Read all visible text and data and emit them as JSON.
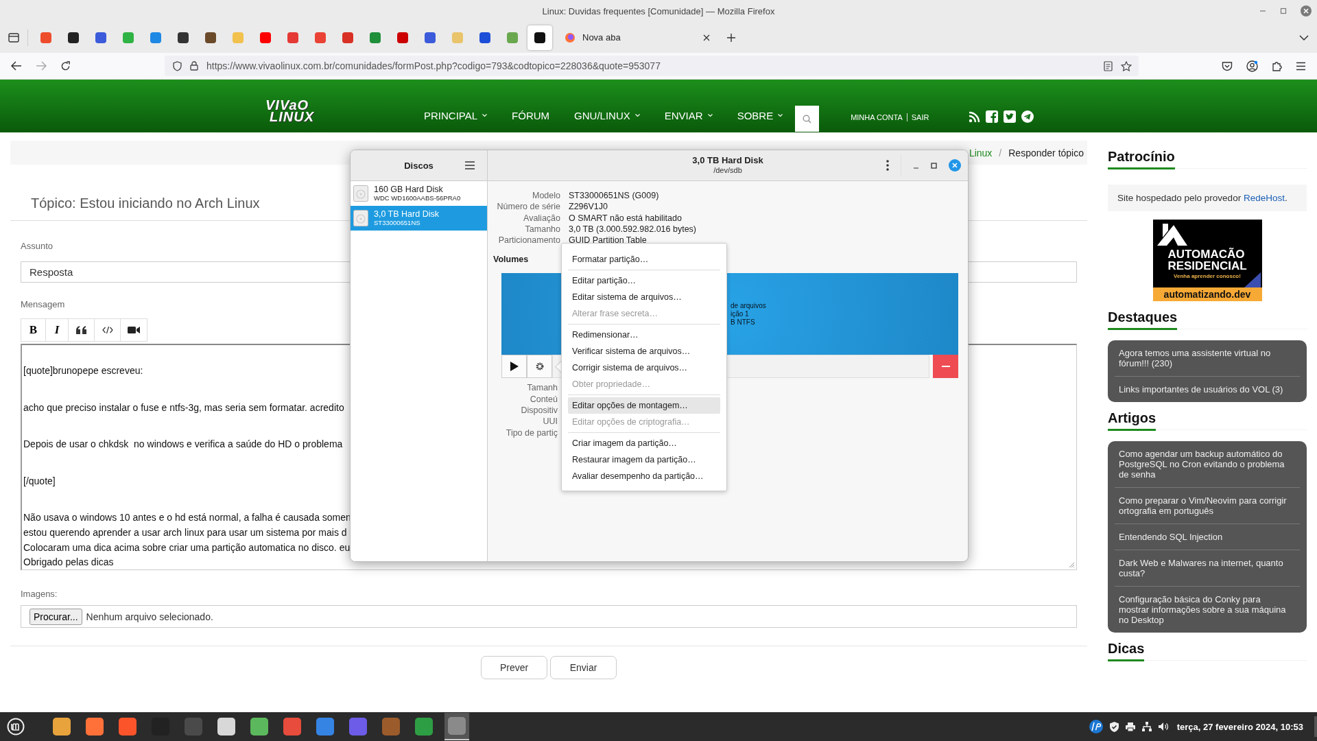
{
  "browser": {
    "window_title": "Linux: Duvidas frequentes [Comunidade] — Mozilla Firefox",
    "pinned_tabs": [
      {
        "color": "#ee4d2d",
        "selected": false
      },
      {
        "color": "#222222",
        "selected": false
      },
      {
        "color": "#3b5bdb",
        "selected": false
      },
      {
        "color": "#2fb344",
        "selected": false
      },
      {
        "color": "#1e88e5",
        "selected": false
      },
      {
        "color": "#333333",
        "selected": false
      },
      {
        "color": "#6b4a2a",
        "selected": false
      },
      {
        "color": "#f2c14e",
        "selected": false
      },
      {
        "color": "#ff0000",
        "selected": false
      },
      {
        "color": "#e53935",
        "selected": false
      },
      {
        "color": "#ea4335",
        "selected": false
      },
      {
        "color": "#d93025",
        "selected": false
      },
      {
        "color": "#1f8f3a",
        "selected": false
      },
      {
        "color": "#cc0000",
        "selected": false
      },
      {
        "color": "#3b5bdb",
        "selected": false
      },
      {
        "color": "#e9c46a",
        "selected": false
      },
      {
        "color": "#1d4ed8",
        "selected": false
      },
      {
        "color": "#6aa84f",
        "selected": false
      },
      {
        "color": "#111111",
        "selected": true
      }
    ],
    "tabs": [
      {
        "label": "Nova aba",
        "selected": false
      }
    ],
    "url": "https://www.vivaolinux.com.br/comunidades/formPost.php?codigo=793&codtopico=228036&quote=953077"
  },
  "site_header": {
    "logo": [
      "VIVaO",
      "LINUX"
    ],
    "nav": [
      {
        "label": "PRINCIPAL",
        "dropdown": true
      },
      {
        "label": "FÓRUM",
        "dropdown": false
      },
      {
        "label": "GNU/LINUX",
        "dropdown": true
      },
      {
        "label": "ENVIAR",
        "dropdown": true
      },
      {
        "label": "SOBRE",
        "dropdown": true
      }
    ],
    "account_links": [
      "MINHA CONTA",
      "SAIR"
    ]
  },
  "breadcrumb": {
    "items": [
      "Linux",
      "Responder tópico"
    ],
    "separator": "/"
  },
  "form": {
    "topic_title": "Tópico: Estou iniciando no Arch Linux",
    "subject_label": "Assunto",
    "subject_value": "Resposta",
    "message_label": "Mensagem",
    "editor_tools": [
      {
        "kind": "bold",
        "label": "B"
      },
      {
        "kind": "italic",
        "label": "I"
      },
      {
        "kind": "quote"
      },
      {
        "kind": "code"
      },
      {
        "kind": "video"
      }
    ],
    "message": [
      {
        "lines": [
          "[quote]brunopepe escreveu:"
        ]
      },
      {
        "lines": [
          "acho que preciso instalar o fuse e ntfs-3g, mas seria sem formatar. acredito"
        ]
      },
      {
        "lines": [
          "Depois de usar o chkdsk  no windows e verifica a saúde do HD o problema"
        ]
      },
      {
        "lines": [
          "[/quote]"
        ]
      },
      {
        "lines": [
          "Não usava o windows 10 antes e o hd está normal, a falha é causada somen",
          "estou querendo aprender a usar arch linux para usar um sistema por mais d",
          "Colocaram uma dica acima sobre criar uma partição automatica no disco. eu",
          "Obrigado pelas dicas"
        ]
      }
    ],
    "images_label": "Imagens:",
    "file_button": "Procurar...",
    "file_status": "Nenhum arquivo selecionado.",
    "buttons": [
      "Prever",
      "Enviar"
    ]
  },
  "sidebar": {
    "sponsor": {
      "title": "Patrocínio",
      "text": "Site hospedado pelo provedor",
      "link": "RedeHost",
      "suffix": ".",
      "ad": {
        "headline": [
          "AUTOMACÃO",
          "RESIDENCIAL"
        ],
        "tagline": "Venha aprender conosco!",
        "domain": "automatizando.dev"
      }
    },
    "sections": [
      {
        "title": "Destaques",
        "links": [
          "Agora temos uma assistente virtual no fórum!!! (230)",
          "Links importantes de usuários do VOL (3)"
        ]
      },
      {
        "title": "Artigos",
        "links": [
          "Como agendar um backup automático do PostgreSQL no Cron evitando o problema de senha",
          "Como preparar o Vim/Neovim para corrigir ortografia em português",
          "Entendendo SQL Injection",
          "Dark Web e Malwares na internet, quanto custa?",
          "Configuração básica do Conky para mostrar informações sobre a sua máquina no Desktop"
        ]
      }
    ],
    "last_title": "Dicas"
  },
  "disks_window": {
    "sidebar_title": "Discos",
    "disks": [
      {
        "name": "160 GB Hard Disk",
        "model": "WDC WD1600AABS-56PRA0",
        "selected": false
      },
      {
        "name": "3,0 TB Hard Disk",
        "model": "ST33000651NS",
        "selected": true
      }
    ],
    "title": "3,0 TB Hard Disk",
    "subtitle": "/dev/sdb",
    "properties": [
      {
        "label": "Modelo",
        "value": "ST33000651NS (G009)"
      },
      {
        "label": "Número de série",
        "value": "Z296V1J0"
      },
      {
        "label": "Avaliação",
        "value": "O SMART não está habilitado"
      },
      {
        "label": "Tamanho",
        "value": "3,0 TB (3.000.592.982.016 bytes)"
      },
      {
        "label": "Particionamento",
        "value": "GUID Partition Table"
      }
    ],
    "volumes_title": "Volumes",
    "partition_lines": [
      "de arquivos",
      "ição 1",
      "B NTFS"
    ],
    "volume_labels": [
      "Tamanh",
      "Conteú",
      "Dispositiv",
      "UUI",
      "Tipo de partiç"
    ],
    "context_menu": [
      {
        "items": [
          {
            "label": "Formatar partição…",
            "disabled": false,
            "highlighted": false
          }
        ]
      },
      {
        "items": [
          {
            "label": "Editar partição…",
            "disabled": false,
            "highlighted": false
          },
          {
            "label": "Editar sistema de arquivos…",
            "disabled": false,
            "highlighted": false
          },
          {
            "label": "Alterar frase secreta…",
            "disabled": true,
            "highlighted": false
          }
        ]
      },
      {
        "items": [
          {
            "label": "Redimensionar…",
            "disabled": false,
            "highlighted": false
          },
          {
            "label": "Verificar sistema de arquivos…",
            "disabled": false,
            "highlighted": false
          },
          {
            "label": "Corrigir sistema de arquivos…",
            "disabled": false,
            "highlighted": false
          },
          {
            "label": "Obter propriedade…",
            "disabled": true,
            "highlighted": false
          }
        ]
      },
      {
        "items": [
          {
            "label": "Editar opções de montagem…",
            "disabled": false,
            "highlighted": true
          },
          {
            "label": "Editar opções de criptografia…",
            "disabled": true,
            "highlighted": false
          }
        ]
      },
      {
        "items": [
          {
            "label": "Criar imagem da partição…",
            "disabled": false,
            "highlighted": false
          },
          {
            "label": "Restaurar imagem da partição…",
            "disabled": false,
            "highlighted": false
          },
          {
            "label": "Avaliar desempenho da partição…",
            "disabled": false,
            "highlighted": false
          }
        ]
      }
    ]
  },
  "taskbar": {
    "apps": [
      {
        "color": "#e8a33d",
        "selected": false
      },
      {
        "color": "#ff7139",
        "selected": false
      },
      {
        "color": "#fb542b",
        "selected": false
      },
      {
        "color": "#222222",
        "selected": false
      },
      {
        "color": "#4a4a4a",
        "selected": false
      },
      {
        "color": "#d8d8d8",
        "selected": false
      },
      {
        "color": "#5cb85c",
        "selected": false
      },
      {
        "color": "#e74c3c",
        "selected": false
      },
      {
        "color": "#3584e4",
        "selected": false
      },
      {
        "color": "#6c5ce7",
        "selected": false
      },
      {
        "color": "#9c5b2b",
        "selected": false
      },
      {
        "color": "#2e9e44",
        "selected": false
      },
      {
        "color": "#8a8a8a",
        "selected": true
      }
    ],
    "clock": "terça, 27 fevereiro 2024, 10:53"
  }
}
